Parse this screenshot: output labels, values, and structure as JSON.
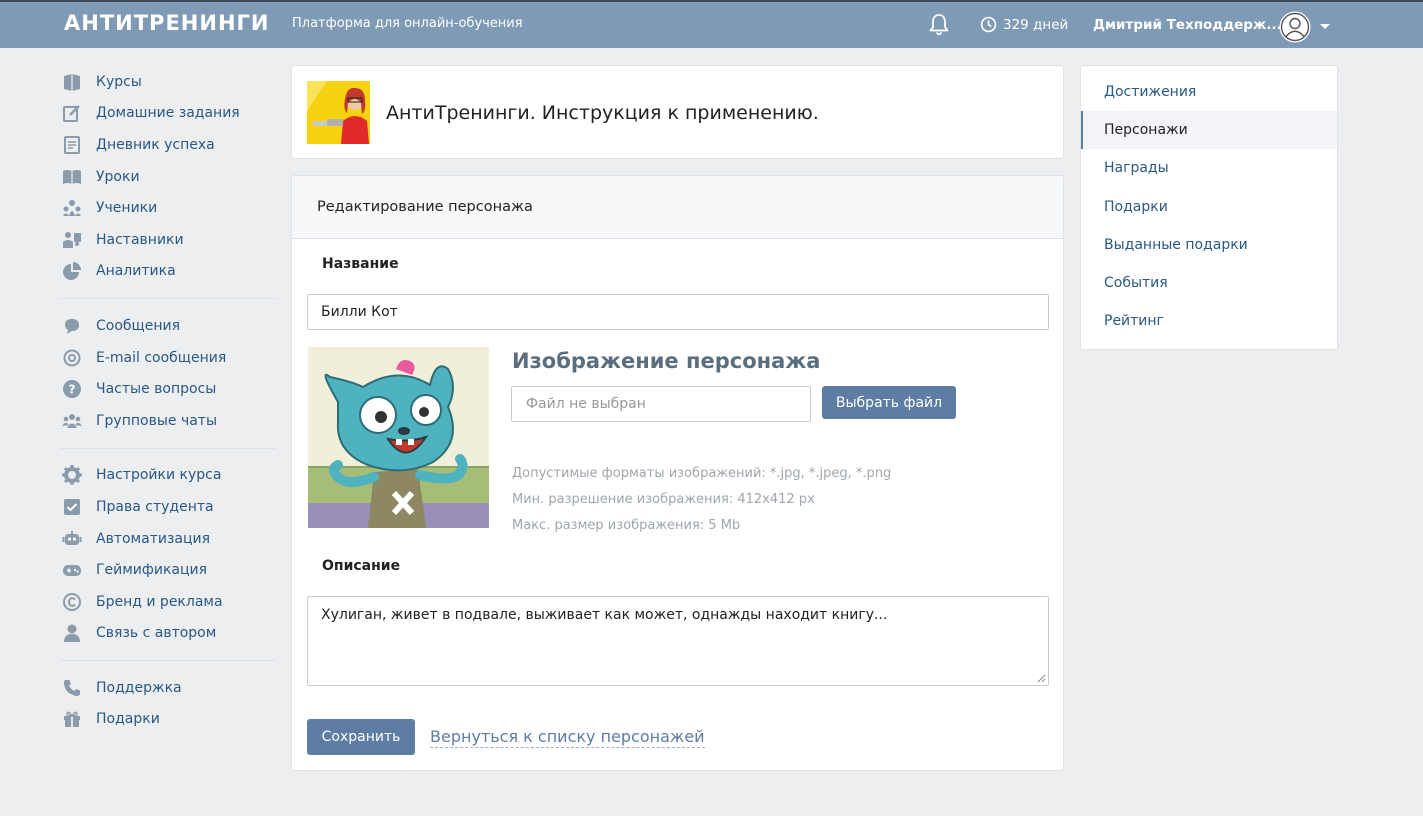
{
  "header": {
    "logo": "АНТИТРЕНИНГИ",
    "tagline": "Платформа для онлайн-обучения",
    "days": "329 дней",
    "user_name": "Дмитрий Техподдерж..."
  },
  "left_nav": {
    "group1": [
      {
        "label": "Курсы",
        "icon": "courses-icon"
      },
      {
        "label": "Домашние задания",
        "icon": "homework-icon"
      },
      {
        "label": "Дневник успеха",
        "icon": "diary-icon"
      },
      {
        "label": "Уроки",
        "icon": "lessons-icon"
      },
      {
        "label": "Ученики",
        "icon": "students-icon"
      },
      {
        "label": "Наставники",
        "icon": "mentors-icon"
      },
      {
        "label": "Аналитика",
        "icon": "analytics-icon"
      }
    ],
    "group2": [
      {
        "label": "Сообщения",
        "icon": "messages-icon"
      },
      {
        "label": "E-mail сообщения",
        "icon": "email-icon"
      },
      {
        "label": "Частые вопросы",
        "icon": "faq-icon"
      },
      {
        "label": "Групповые чаты",
        "icon": "group-chats-icon"
      }
    ],
    "group3": [
      {
        "label": "Настройки курса",
        "icon": "settings-icon"
      },
      {
        "label": "Права студента",
        "icon": "permissions-icon"
      },
      {
        "label": "Автоматизация",
        "icon": "robot-icon"
      },
      {
        "label": "Геймификация",
        "icon": "gamepad-icon"
      },
      {
        "label": "Бренд и реклама",
        "icon": "copyright-icon"
      },
      {
        "label": "Связь с автором",
        "icon": "user-icon"
      }
    ],
    "group4": [
      {
        "label": "Поддержка",
        "icon": "phone-icon"
      },
      {
        "label": "Подарки",
        "icon": "gift-icon"
      }
    ]
  },
  "course": {
    "title": "АнтиТренинги. Инструкция к применению."
  },
  "editor": {
    "heading": "Редактирование персонажа",
    "name_label": "Название",
    "name_value": "Билли Кот",
    "image_title": "Изображение персонажа",
    "file_placeholder": "Файл не выбран",
    "file_button": "Выбрать файл",
    "hints": [
      "Допустимые форматы изображений: *.jpg, *.jpeg, *.png",
      "Мин. разрешение изображения: 412x412 px",
      "Макс. размер изображения: 5 Mb"
    ],
    "description_label": "Описание",
    "description_value": "Хулиган, живет в подвале, выживает как может, однажды находит книгу...",
    "save_button": "Сохранить",
    "back_link": "Вернуться к списку персонажей"
  },
  "right_menu": {
    "items": [
      {
        "label": "Достижения",
        "active": false
      },
      {
        "label": "Персонажи",
        "active": true
      },
      {
        "label": "Награды",
        "active": false
      },
      {
        "label": "Подарки",
        "active": false
      },
      {
        "label": "Выданные подарки",
        "active": false
      },
      {
        "label": "События",
        "active": false
      },
      {
        "label": "Рейтинг",
        "active": false
      }
    ]
  },
  "colors": {
    "header_bg": "#7e9ab5",
    "accent": "#5d7da3",
    "link": "#2a5885",
    "icon": "#8a9bac"
  }
}
